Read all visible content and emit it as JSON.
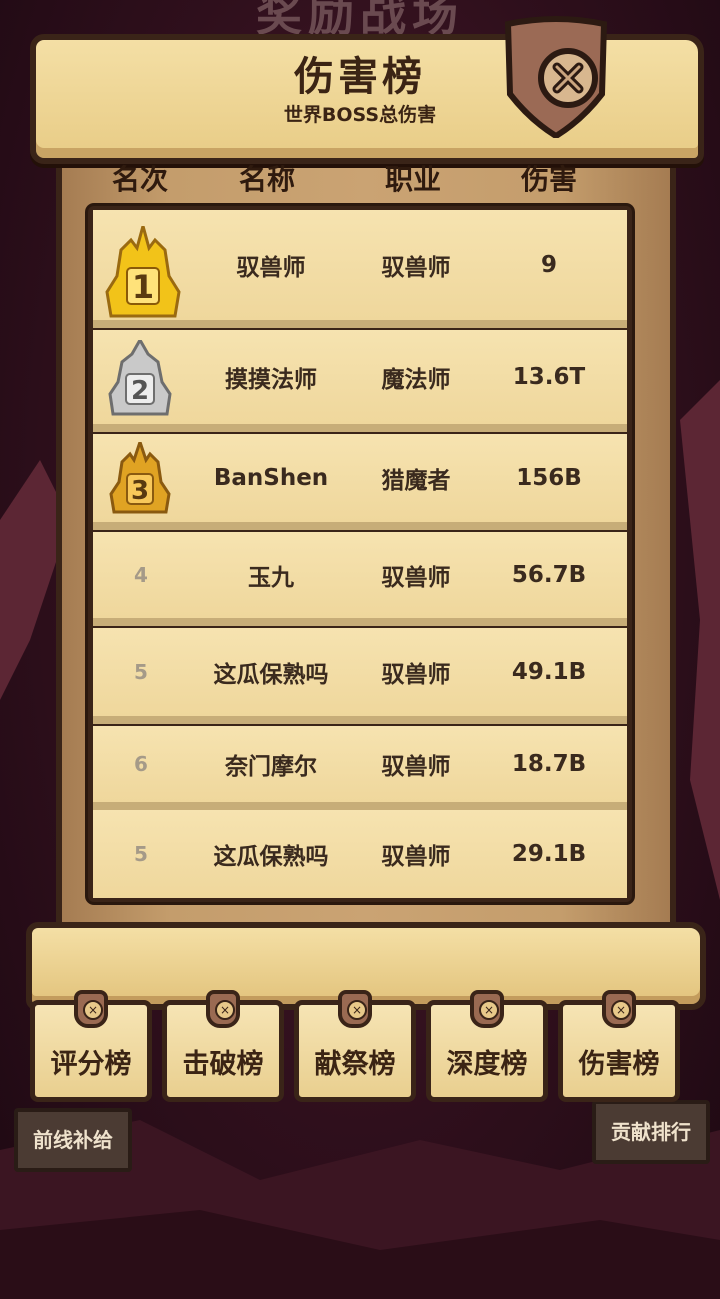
{
  "background": {
    "title": "奖励战场"
  },
  "panel": {
    "title": "伤害榜",
    "subtitle": "世界BOSS总伤害",
    "close_icon": "close-x-icon"
  },
  "table": {
    "headers": [
      "名次",
      "名称",
      "职业",
      "伤害"
    ],
    "rows": [
      {
        "rank": "1",
        "rank_icon": "gold-medal-icon",
        "name": "驭兽师",
        "class": "驭兽师",
        "damage": "9"
      },
      {
        "rank": "2",
        "rank_icon": "silver-medal-icon",
        "name": "摸摸法师",
        "class": "魔法师",
        "damage": "13.6T"
      },
      {
        "rank": "3",
        "rank_icon": "bronze-medal-icon",
        "name": "BanShen",
        "class": "猎魔者",
        "damage": "156B"
      },
      {
        "rank": "4",
        "name": "玉九",
        "class": "驭兽师",
        "damage": "56.7B"
      },
      {
        "rank": "5",
        "name": "这瓜保熟吗",
        "class": "驭兽师",
        "damage": "49.1B"
      },
      {
        "rank": "6",
        "name": "奈门摩尔",
        "class": "驭兽师",
        "damage": "18.7B"
      },
      {
        "rank": "5",
        "name": "这瓜保熟吗",
        "class": "驭兽师",
        "damage": "29.1B"
      }
    ]
  },
  "tabs": [
    "评分榜",
    "击破榜",
    "献祭榜",
    "深度榜",
    "伤害榜"
  ],
  "side_buttons": {
    "left": "前线补给",
    "right": "贡献排行"
  },
  "colors": {
    "parchment": "#f6e3b0",
    "ink": "#3a2418",
    "gold": "#f2c319",
    "silver": "#c9c9c9",
    "bronze": "#e0a323"
  }
}
